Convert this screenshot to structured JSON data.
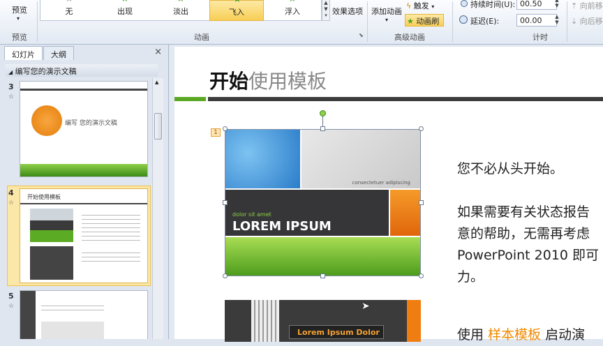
{
  "ribbon": {
    "preview_label": "预览",
    "preview_group": "预览",
    "animations": [
      {
        "label": "无",
        "icon": "star-outline-icon",
        "selected": false
      },
      {
        "label": "出现",
        "icon": "star-green-icon",
        "selected": false
      },
      {
        "label": "淡出",
        "icon": "star-green-icon",
        "selected": false
      },
      {
        "label": "飞入",
        "icon": "star-green-icon",
        "selected": true
      },
      {
        "label": "浮入",
        "icon": "star-green-icon",
        "selected": false
      }
    ],
    "effect_options": "效果选项",
    "animation_group": "动画",
    "add_animation": "添加动画",
    "trigger": "触发",
    "animation_painter": "动画刷",
    "advanced_group": "高级动画",
    "duration_label": "持续时间(U):",
    "duration_value": "00.50",
    "delay_label": "延迟(E):",
    "delay_value": "00.00",
    "timing_group": "计时",
    "move_earlier": "向前移",
    "move_later": "向后移"
  },
  "pane": {
    "tabs": [
      "幻灯片",
      "大纲"
    ],
    "active_tab": 0,
    "close": "×",
    "section": "编写您的演示文稿",
    "slides": [
      {
        "num": "3",
        "title": "编写 您的演示文稿"
      },
      {
        "num": "4",
        "title": "开始使用模板",
        "selected": true
      },
      {
        "num": "5",
        "title": ""
      }
    ]
  },
  "slide": {
    "title_bold": "开始",
    "title_light": "使用模板",
    "anim_tag": "1",
    "image1_small": "consectetuer adipiscing",
    "image1_sub": "dolor sit amet",
    "image1_big": "LOREM IPSUM",
    "image2_text": "Lorem Ipsum Dolor",
    "lines": [
      "您不必从头开始。",
      "如果需要有关状态报告",
      "意的帮助，无需再考虑",
      "PowerPoint 2010 即可",
      "力。"
    ],
    "last_prefix": "使用",
    "last_highlight": "样本模板",
    "last_suffix": "启动演"
  },
  "colors": {
    "accent_green": "#5aa823",
    "accent_orange": "#f08a00",
    "selected_gold": "#f8cf56"
  }
}
